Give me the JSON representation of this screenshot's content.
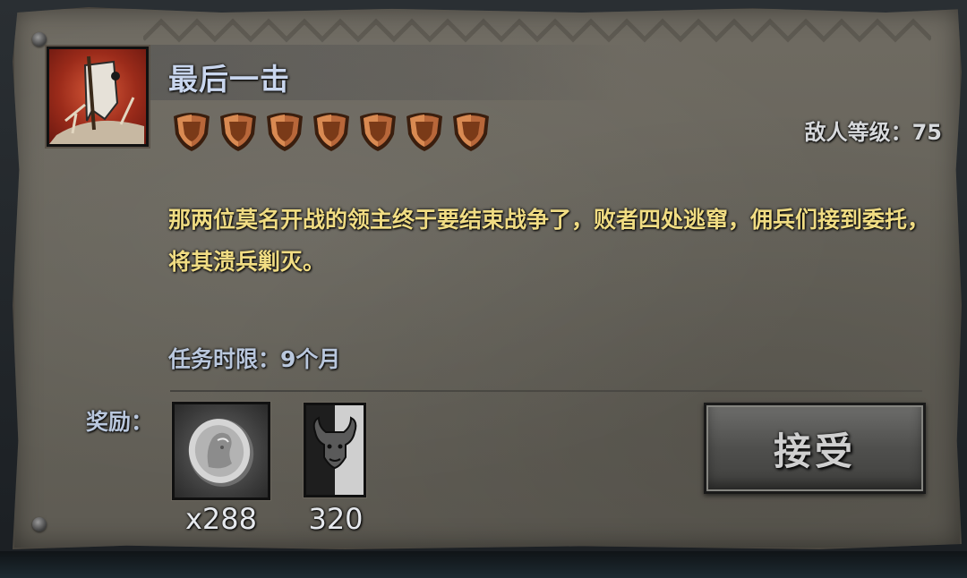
{
  "quest": {
    "title": "最后一击",
    "difficulty_shields": 7,
    "enemy_level": "敌人等级：75",
    "description": "那两位莫名开战的领主终于要结束战争了，败者四处逃窜，佣兵们接到委托，将其溃兵剿灭。",
    "time_limit": "任务时限：9个月",
    "icon": "shattered-banner-icon"
  },
  "rewards": {
    "label": "奖励：",
    "items": [
      {
        "icon": "silver-coin-icon",
        "amount": "x288"
      },
      {
        "icon": "bull-banner-icon",
        "amount": "320"
      }
    ]
  },
  "actions": {
    "accept_label": "接受"
  },
  "colors": {
    "title": "#c9d6ee",
    "description": "#f0dc83",
    "label": "#b9c7dd",
    "parchment": "#67645b",
    "shield": "#b8673a"
  }
}
